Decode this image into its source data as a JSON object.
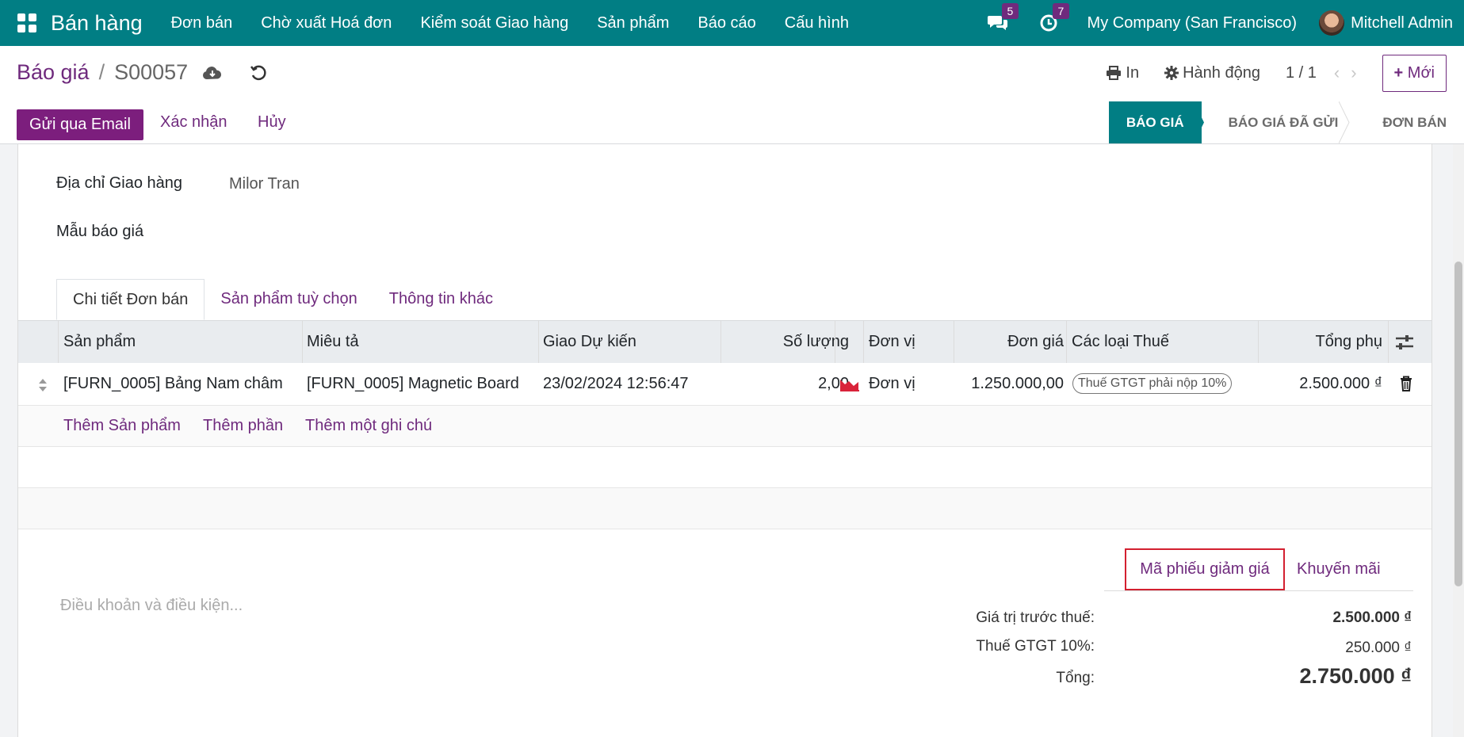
{
  "nav": {
    "brand": "Bán hàng",
    "menu": [
      "Đơn bán",
      "Chờ xuất Hoá đơn",
      "Kiểm soát Giao hàng",
      "Sản phẩm",
      "Báo cáo",
      "Cấu hình"
    ],
    "messages_count": "5",
    "activities_count": "7",
    "company": "My Company (San Francisco)",
    "user": "Mitchell Admin",
    "accent": "#017e84"
  },
  "control": {
    "breadcrumb_parent": "Báo giá",
    "breadcrumb_sep": "/",
    "breadcrumb_current": "S00057",
    "print_label": "In",
    "action_label": "Hành động",
    "pager": "1 / 1",
    "pager_prev": "‹",
    "pager_next": "›",
    "new_label": "Mới",
    "new_plus": "+"
  },
  "actions": {
    "send_email": "Gửi qua Email",
    "confirm": "Xác nhận",
    "cancel": "Hủy"
  },
  "status": {
    "stages": [
      "BÁO GIÁ",
      "BÁO GIÁ ĐÃ GỬI",
      "ĐƠN BÁN"
    ],
    "active": "BÁO GIÁ"
  },
  "form": {
    "delivery_label": "Địa chỉ Giao hàng",
    "delivery_value": "Milor Tran",
    "template_label": "Mẫu báo giá"
  },
  "tabs": [
    "Chi tiết Đơn bán",
    "Sản phẩm tuỳ chọn",
    "Thông tin khác"
  ],
  "table": {
    "headers": {
      "product": "Sản phẩm",
      "description": "Miêu tả",
      "delivery_date": "Giao Dự kiến",
      "qty": "Số lượng",
      "uom": "Đơn vị",
      "price": "Đơn giá",
      "taxes": "Các loại Thuế",
      "subtotal": "Tổng phụ"
    },
    "rows": [
      {
        "product": "[FURN_0005] Bảng Nam châm",
        "description": "[FURN_0005] Magnetic Board",
        "delivery_date": "23/02/2024 12:56:47",
        "qty": "2,00",
        "uom": "Đơn vị",
        "price": "1.250.000,00",
        "tax": "Thuế GTGT phải nộp 10%",
        "subtotal": "2.500.000 ₫"
      }
    ],
    "add_product": "Thêm Sản phẩm",
    "add_section": "Thêm phần",
    "add_note": "Thêm một ghi chú"
  },
  "footer": {
    "terms_placeholder": "Điều khoản và điều kiện...",
    "coupon_button": "Mã phiếu giảm giá",
    "promo_button": "Khuyến mãi",
    "untaxed_label": "Giá trị trước thuế:",
    "untaxed_value": "2.500.000 ₫",
    "tax_label": "Thuế GTGT 10%:",
    "tax_value": "250.000 ₫",
    "total_label": "Tổng:",
    "total_value": "2.750.000 ₫"
  }
}
